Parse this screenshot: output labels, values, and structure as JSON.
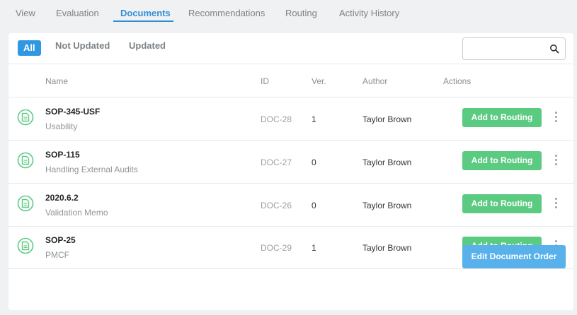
{
  "tabs": [
    {
      "label": "View"
    },
    {
      "label": "Evaluation"
    },
    {
      "label": "Documents"
    },
    {
      "label": "Recommendations"
    },
    {
      "label": "Routing"
    },
    {
      "label": "Activity History"
    }
  ],
  "active_tab": "Documents",
  "filters": [
    {
      "label": "All"
    },
    {
      "label": "Not Updated"
    },
    {
      "label": "Updated"
    }
  ],
  "active_filter": "All",
  "search": {
    "placeholder": "",
    "value": "",
    "icon": "search-icon"
  },
  "table": {
    "columns": [
      "Name",
      "ID",
      "Ver.",
      "Author",
      "Actions"
    ],
    "rows": [
      {
        "title": "SOP-345-USF",
        "subtitle": "Usability",
        "id": "DOC-28",
        "version": "1",
        "author": "Taylor Brown",
        "action": "Add to Routing"
      },
      {
        "title": "SOP-115",
        "subtitle": "Handling External Audits",
        "id": "DOC-27",
        "version": "0",
        "author": "Taylor Brown",
        "action": "Add to Routing"
      },
      {
        "title": "2020.6.2",
        "subtitle": "Validation Memo",
        "id": "DOC-26",
        "version": "0",
        "author": "Taylor Brown",
        "action": "Add to Routing"
      },
      {
        "title": "SOP-25",
        "subtitle": "PMCF",
        "id": "DOC-29",
        "version": "1",
        "author": "Taylor Brown",
        "action": "Add to Routing"
      }
    ]
  },
  "footer": {
    "edit_order_label": "Edit Document Order"
  },
  "colors": {
    "accent": "#2f8fd6",
    "filter_active": "#2f98e3",
    "route_button": "#5ccb82",
    "edit_button": "#58b1eb",
    "doc_icon": "#5ccb82"
  }
}
